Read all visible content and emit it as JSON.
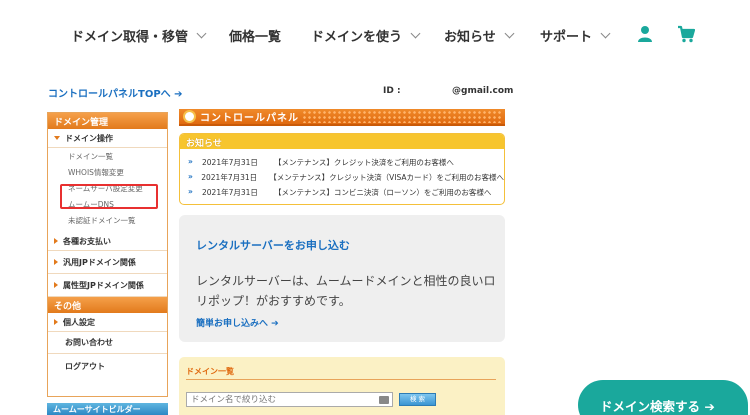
{
  "nav": {
    "items": [
      {
        "label": "ドメイン取得・移管"
      },
      {
        "label": "価格一覧"
      },
      {
        "label": "ドメインを使う"
      },
      {
        "label": "お知らせ"
      },
      {
        "label": "サポート"
      }
    ],
    "accent_color": "#1aa89c"
  },
  "header": {
    "cp_top_link": "コントロールパネルTOPへ ➔",
    "id_label": "ID :",
    "id_email": "@gmail.com"
  },
  "sidebar": {
    "section1_title": "ドメイン管理",
    "domain_ops": "ドメイン操作",
    "sub_items": [
      "ドメイン一覧",
      "WHOIS情報変更",
      "ネームサーバ設定変更",
      "ムームーDNS",
      "未認証ドメイン一覧"
    ],
    "groups": [
      "各種お支払い",
      "汎用JPドメイン関係",
      "属性型JPドメイン関係"
    ],
    "section2_title": "その他",
    "personal": "個人設定",
    "contact": "お問い合わせ",
    "logout": "ログアウト",
    "banner": "ムームーサイトビルダー"
  },
  "main": {
    "cp_title": "コントロールパネル",
    "notice_title": "お知らせ",
    "news": [
      {
        "date": "2021年7月31日",
        "text": "【メンテナンス】クレジット決済をご利用のお客様へ"
      },
      {
        "date": "2021年7月31日",
        "text": "【メンテナンス】クレジット決済（VISAカード）をご利用のお客様へ"
      },
      {
        "date": "2021年7月31日",
        "text": "【メンテナンス】コンビニ決済（ローソン）をご利用のお客様へ"
      }
    ],
    "rental_title": "レンタルサーバーをお申し込む",
    "rental_text": "レンタルサーバーは、ムームードメインと相性の良いロリポップ！がおすすめです。",
    "rental_link": "簡単お申し込みへ ➔",
    "domlist_title": "ドメイン一覧",
    "domlist_placeholder": "ドメイン名で絞り込む",
    "domlist_button": "検 索"
  },
  "cta": {
    "label": "ドメイン検索する ➔"
  }
}
